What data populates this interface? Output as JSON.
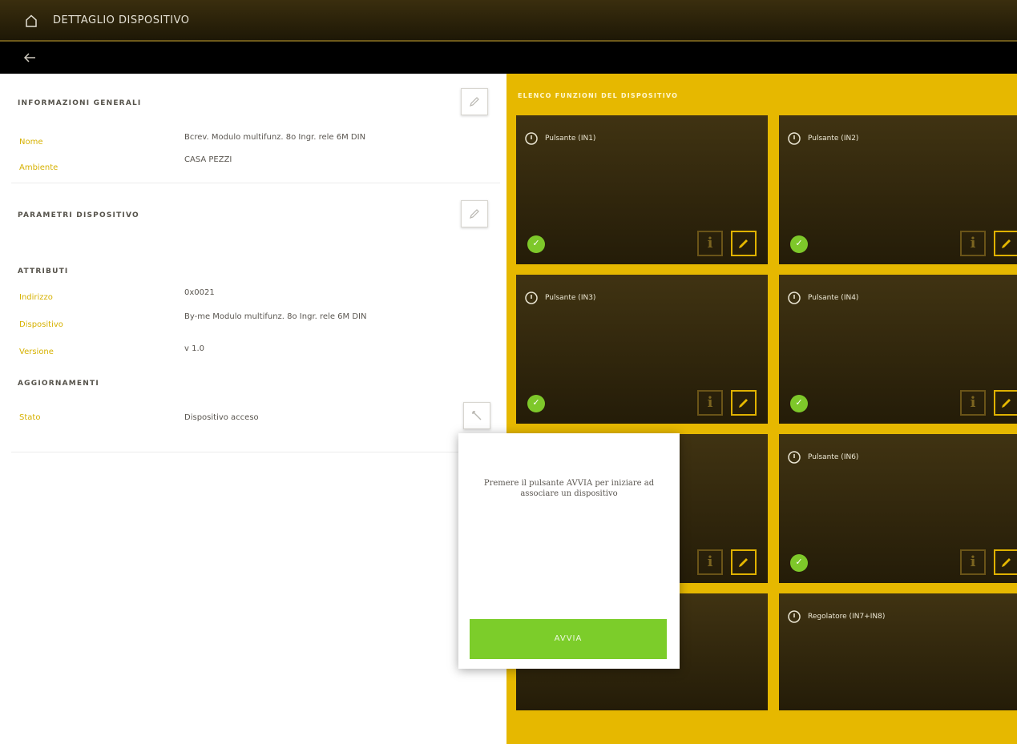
{
  "header": {
    "title": "DETTAGLIO DISPOSITIVO"
  },
  "info_section": {
    "title": "INFORMAZIONI GENERALI",
    "rows": [
      {
        "label": "Nome",
        "value": "Bcrev. Modulo multifunz. 8o Ingr. rele 6M DIN"
      },
      {
        "label": "Ambiente",
        "value": "CASA PEZZI"
      }
    ]
  },
  "params_section": {
    "title": "PARAMETRI DISPOSITIVO",
    "subtitle": "ATTRIBUTI",
    "rows": [
      {
        "label": "Indirizzo",
        "value": "0x0021"
      },
      {
        "label": "Dispositivo",
        "value": "By-me Modulo multifunz. 8o Ingr. rele 6M DIN"
      },
      {
        "label": "Versione",
        "value": "v 1.0"
      }
    ]
  },
  "update_section": {
    "title": "AGGIORNAMENTI",
    "label": "Stato",
    "value": "Dispositivo acceso"
  },
  "functions": {
    "title": "ELENCO FUNZIONI DEL DISPOSITIVO",
    "cards": [
      {
        "name": "Pulsante (IN1)"
      },
      {
        "name": "Pulsante (IN2)"
      },
      {
        "name": "Pulsante (IN3)"
      },
      {
        "name": "Pulsante (IN4)"
      },
      {
        "name": ""
      },
      {
        "name": "Pulsante (IN6)"
      },
      {
        "name": ""
      },
      {
        "name": "Regolatore (IN7+IN8)"
      }
    ]
  },
  "popup": {
    "message": "Premere il pulsante AVVIA per iniziare ad associare un dispositivo",
    "button": "AVVIA"
  },
  "colors": {
    "accent": "#e6b800",
    "status_ok": "#7ec82a",
    "card_bg": "#2e240b"
  }
}
